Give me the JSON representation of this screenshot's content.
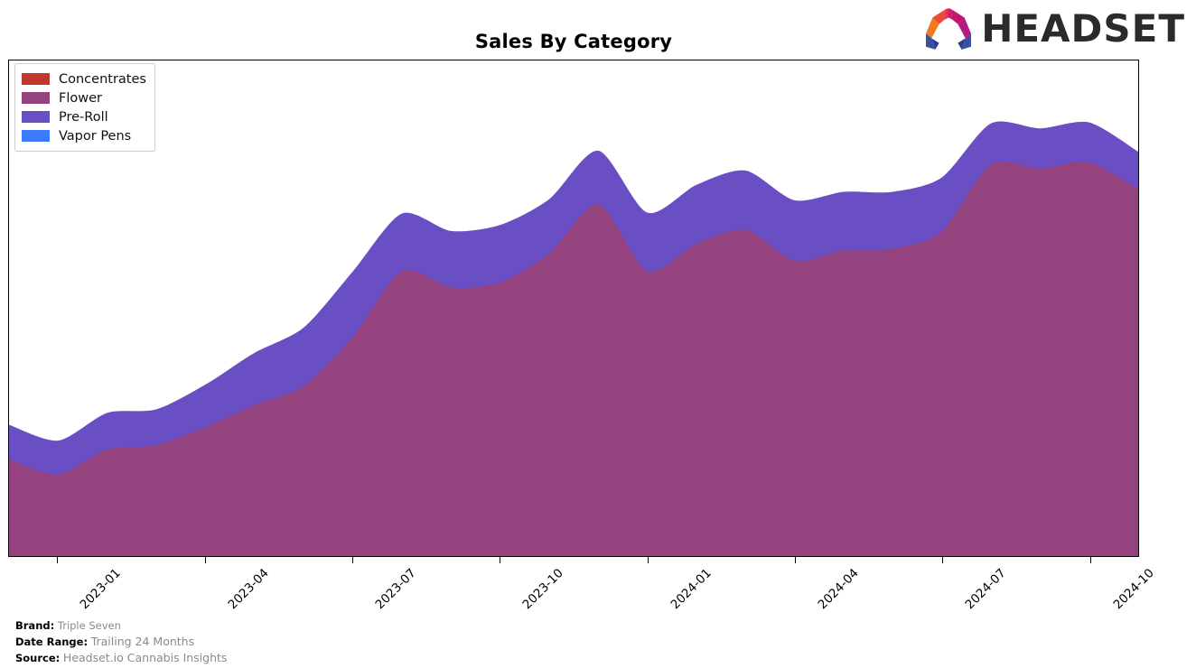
{
  "header": {
    "title": "Sales By Category",
    "logo_text": "HEADSET",
    "logo_icon": "headset-arch-logo"
  },
  "legend": {
    "position": "upper-left",
    "items": [
      {
        "label": "Concentrates",
        "color": "#c0392f"
      },
      {
        "label": "Flower",
        "color": "#95437f"
      },
      {
        "label": "Pre-Roll",
        "color": "#6a4fc4"
      },
      {
        "label": "Vapor Pens",
        "color": "#3d7afc"
      }
    ]
  },
  "footer": {
    "brand_key": "Brand:",
    "brand_value": "Triple Seven",
    "date_range_key": "Date Range:",
    "date_range_value": "Trailing 24 Months",
    "source_key": "Source:",
    "source_value": "Headset.io Cannabis Insights"
  },
  "chart_data": {
    "type": "area",
    "stacked": true,
    "title": "Sales By Category",
    "xlabel": "",
    "ylabel": "",
    "grid": false,
    "legend_position": "upper-left",
    "axis_y_ticks_visible": false,
    "smoothing": "spline",
    "x": [
      "2022-12",
      "2023-01",
      "2023-02",
      "2023-03",
      "2023-04",
      "2023-05",
      "2023-06",
      "2023-07",
      "2023-08",
      "2023-09",
      "2023-10",
      "2023-11",
      "2023-12",
      "2024-01",
      "2024-02",
      "2024-03",
      "2024-04",
      "2024-05",
      "2024-06",
      "2024-07",
      "2024-08",
      "2024-09",
      "2024-10",
      "2024-11"
    ],
    "tick_labels": [
      "2023-01",
      "2023-04",
      "2023-07",
      "2023-10",
      "2024-01",
      "2024-04",
      "2024-07",
      "2024-10"
    ],
    "ylim": [
      0,
      100
    ],
    "series": [
      {
        "name": "Concentrates",
        "color": "#c0392f",
        "values": [
          0,
          0,
          0,
          0,
          0,
          0,
          0,
          0,
          0,
          0,
          0,
          0,
          0,
          0,
          0,
          0,
          0,
          0,
          0,
          0,
          0,
          0,
          0,
          0
        ]
      },
      {
        "name": "Flower",
        "color": "#95437f",
        "values": [
          19.5,
          16.5,
          21.5,
          22.4,
          26.0,
          30.5,
          34.3,
          44.2,
          57.5,
          54.2,
          55.2,
          61.0,
          71.0,
          57.5,
          63.0,
          65.8,
          59.6,
          61.6,
          62.0,
          65.5,
          79.0,
          78.2,
          79.5,
          74.0
        ]
      },
      {
        "name": "Pre-Roll",
        "color": "#6a4fc4",
        "values": [
          7.0,
          6.8,
          7.4,
          7.2,
          8.6,
          10.5,
          11.8,
          13.2,
          11.6,
          11.4,
          11.6,
          11.0,
          10.8,
          11.8,
          11.9,
          12.0,
          12.2,
          11.9,
          11.5,
          10.9,
          8.3,
          8.1,
          8.0,
          7.6
        ]
      },
      {
        "name": "Vapor Pens",
        "color": "#3d7afc",
        "values": [
          0,
          0,
          0,
          0,
          0,
          0,
          0,
          0,
          0,
          0,
          0,
          0,
          0,
          0,
          0,
          0,
          0,
          0,
          0,
          0,
          0,
          0,
          0,
          0
        ]
      }
    ]
  }
}
